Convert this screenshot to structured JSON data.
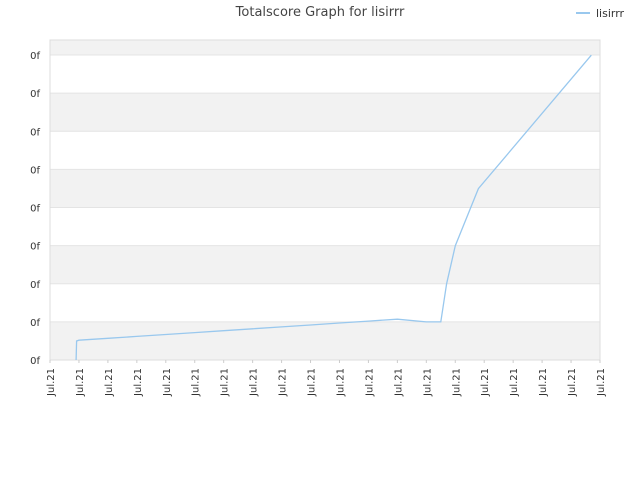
{
  "chart_data": {
    "type": "line",
    "title": "Totalscore Graph for lisirrr",
    "xlabel": "",
    "ylabel": "",
    "legend": {
      "position": "top-right",
      "entries": [
        "lisirrr"
      ]
    },
    "grid": true,
    "y_tick_labels": [
      "0f",
      "0f",
      "0f",
      "0f",
      "0f",
      "0f",
      "0f",
      "0f",
      "0f"
    ],
    "x_tick_labels": [
      "Jul.21",
      "Jul.21",
      "Jul.21",
      "Jul.21",
      "Jul.21",
      "Jul.21",
      "Jul.21",
      "Jul.21",
      "Jul.21",
      "Jul.21",
      "Jul.21",
      "Jul.21",
      "Jul.21",
      "Jul.21",
      "Jul.21",
      "Jul.21",
      "Jul.21",
      "Jul.21",
      "Jul.21",
      "Jul.21"
    ],
    "xlim": [
      0,
      19
    ],
    "ylim": [
      0,
      8.4
    ],
    "series": [
      {
        "name": "lisirrr",
        "color": "#99c8ee",
        "x": [
          0.9,
          0.92,
          1.0,
          2.0,
          3.0,
          4.0,
          5.0,
          6.0,
          7.0,
          8.0,
          9.0,
          10.0,
          11.0,
          12.0,
          13.0,
          13.5,
          13.7,
          14.0,
          14.8,
          18.7
        ],
        "y": [
          0,
          0.5,
          0.52,
          0.57,
          0.62,
          0.67,
          0.72,
          0.77,
          0.82,
          0.87,
          0.92,
          0.97,
          1.02,
          1.07,
          1.0,
          1.0,
          2.0,
          3.0,
          4.5,
          8.0
        ]
      }
    ]
  }
}
